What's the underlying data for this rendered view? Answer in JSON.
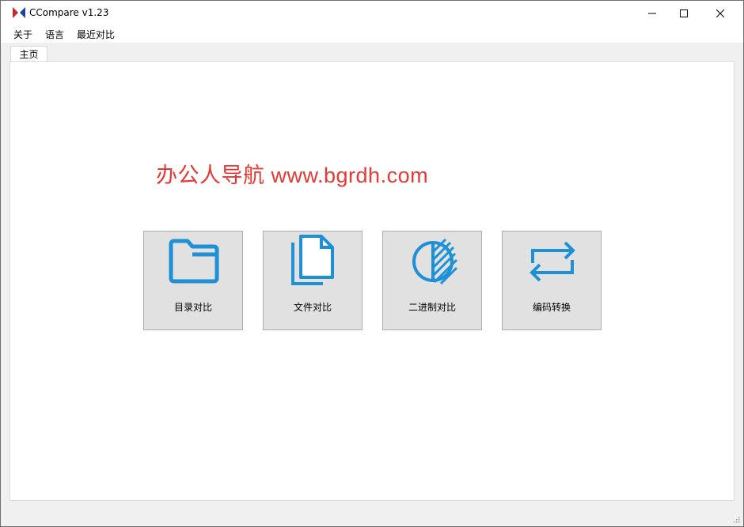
{
  "window": {
    "title": "CCompare  v1.23"
  },
  "menu": {
    "items": [
      "关于",
      "语言",
      "最近对比"
    ]
  },
  "tabs": [
    {
      "label": "主页"
    }
  ],
  "watermark": {
    "text": "办公人导航  www.bgrdh.com",
    "color": "#e53935"
  },
  "tiles": [
    {
      "label": "目录对比",
      "icon": "folder-icon"
    },
    {
      "label": "文件对比",
      "icon": "files-icon"
    },
    {
      "label": "二进制对比",
      "icon": "binary-circle-icon"
    },
    {
      "label": "编码转换",
      "icon": "convert-arrows-icon"
    }
  ],
  "colors": {
    "icon_blue": "#1e90d6",
    "tile_bg": "#e1e1e1",
    "accent_red": "#e53935"
  }
}
